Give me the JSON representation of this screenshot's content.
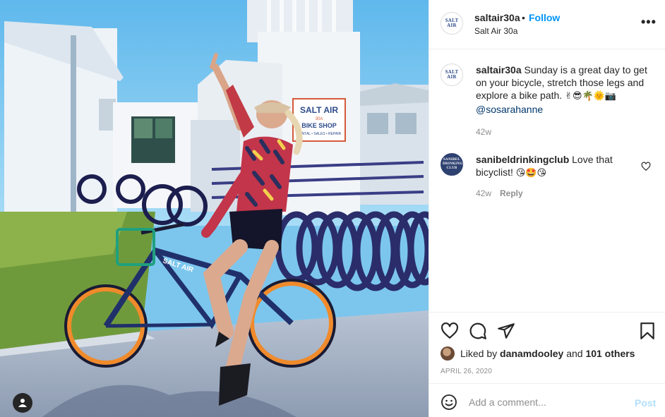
{
  "post": {
    "username": "saltair30a",
    "separator": "•",
    "follow_label": "Follow",
    "location": "Salt Air 30a",
    "more_label": "•••",
    "avatar_text": "SALT AIR"
  },
  "photo": {
    "sign_line1": "SALT AIR",
    "sign_line2": "30A",
    "sign_line3": "BIKE SHOP",
    "sign_line4": "RENTAL • SALES • REPAIR",
    "bike_frame_text": "SALT AIR"
  },
  "caption": {
    "username": "saltair30a",
    "text": "Sunday is a great day to get on your bicycle, stretch those legs and explore a bike path.",
    "emojis": "✌😎🌴🌞📷",
    "mention": "@sosarahanne",
    "age": "42w"
  },
  "comments": [
    {
      "username": "sanibeldrinkingclub",
      "avatar_text": "SANIBEL DRINKING CLUB",
      "text": "Love that bicyclist!",
      "emojis": "😘🤩😘",
      "age": "42w",
      "reply_label": "Reply"
    }
  ],
  "likes": {
    "prefix": "Liked by",
    "user": "danamdooley",
    "mid": "and",
    "others": "101 others"
  },
  "date": "APRIL 26, 2020",
  "add_comment": {
    "placeholder": "Add a comment...",
    "post_label": "Post"
  },
  "icons": {
    "heart": "heart-icon",
    "comment": "comment-icon",
    "share": "paper-plane-icon",
    "save": "bookmark-icon",
    "emoji": "smiley-icon",
    "user_tags": "user-icon",
    "comment_like": "heart-icon"
  },
  "colors": {
    "link_blue": "#0095f6",
    "mention_blue": "#00376b",
    "muted": "#8e8e8e",
    "post_disabled": "#b2dffc",
    "divider": "#efefef"
  }
}
